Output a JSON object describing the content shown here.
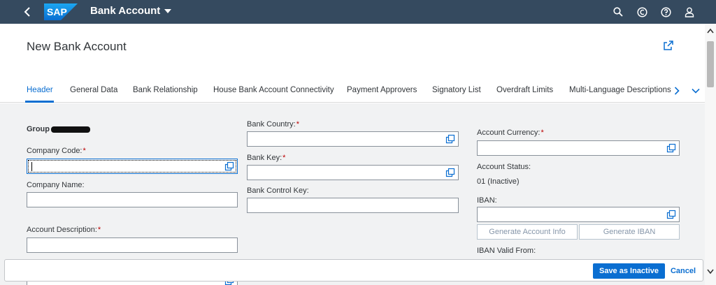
{
  "shell": {
    "logo_text": "SAP",
    "app_title": "Bank Account",
    "icons": [
      "back-icon",
      "search-icon",
      "notification-icon",
      "help-icon",
      "user-icon"
    ]
  },
  "header": {
    "title": "New Bank Account",
    "tabs": [
      {
        "label": "Header",
        "active": true
      },
      {
        "label": "General Data"
      },
      {
        "label": "Bank Relationship"
      },
      {
        "label": "House Bank Account Connectivity"
      },
      {
        "label": "Payment Approvers"
      },
      {
        "label": "Signatory List"
      },
      {
        "label": "Overdraft Limits"
      },
      {
        "label": "Multi-Language Descriptions"
      }
    ]
  },
  "form": {
    "group_label": "Group",
    "company_code_label": "Company Code:",
    "company_name_label": "Company Name:",
    "account_description_label": "Account Description:",
    "bank_country_label": "Bank Country:",
    "bank_key_label": "Bank Key:",
    "bank_control_key_label": "Bank Control Key:",
    "account_currency_label": "Account Currency:",
    "account_status_label": "Account Status:",
    "account_status_value": "01 (Inactive)",
    "iban_label": "IBAN:",
    "generate_account_info": "Generate Account Info",
    "generate_iban": "Generate IBAN",
    "iban_valid_from_label": "IBAN Valid From:",
    "required_marker": "*"
  },
  "footer": {
    "save_label": "Save as Inactive",
    "cancel_label": "Cancel"
  },
  "colors": {
    "shell": "#354a5f",
    "accent": "#0a6ed1",
    "required": "#bb0000",
    "background": "#f1f2f3"
  }
}
